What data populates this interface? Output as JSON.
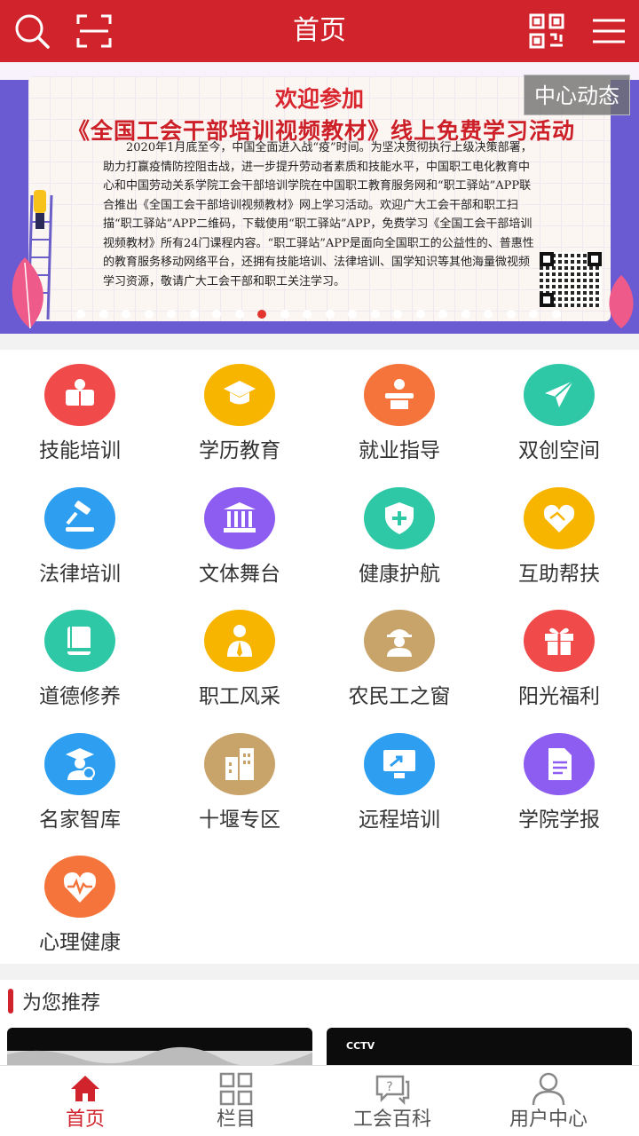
{
  "header": {
    "title": "首页",
    "left_icons": [
      "search-icon",
      "scan-icon"
    ],
    "right_icons": [
      "qrcode-icon",
      "menu-icon"
    ],
    "bg_color": "#d0232c"
  },
  "banner": {
    "headline": "欢迎参加",
    "title": "《全国工会干部培训视频教材》线上免费学习活动",
    "body": "2020年1月底至今，中国全面进入战“疫”时间。为坚决贯彻执行上级决策部署，助力打赢疫情防控阻击战，进一步提升劳动者素质和技能水平，中国职工电化教育中心和中国劳动关系学院工会干部培训学院在中国职工教育服务网和“职工驿站”APP联合推出《全国工会干部培训视频教材》网上学习活动。欢迎广大工会干部和职工扫描“职工驿站”APP二维码，下载使用“职工驿站”APP，免费学习《全国工会干部培训视频教材》所有24门课程内容。“职工驿站”APP是面向全国职工的公益性的、普惠性的教育服务移动网络平台，还拥有技能培训、法律培训、国学知识等其他海量微视频学习资源，敬请广大工会干部和职工关注学习。",
    "tag": "中心动态",
    "dot_count": 22,
    "active_dot": 8
  },
  "grid": {
    "items": [
      {
        "label": "技能培训",
        "icon": "reading-icon",
        "color": "#f04a4a"
      },
      {
        "label": "学历教育",
        "icon": "graduation-cap-icon",
        "color": "#f7b500"
      },
      {
        "label": "就业指导",
        "icon": "speaker-podium-icon",
        "color": "#f5743b"
      },
      {
        "label": "双创空间",
        "icon": "paper-plane-icon",
        "color": "#2ec8a6"
      },
      {
        "label": "法律培训",
        "icon": "gavel-icon",
        "color": "#2e9ff0"
      },
      {
        "label": "文体舞台",
        "icon": "building-columns-icon",
        "color": "#8c5df0"
      },
      {
        "label": "健康护航",
        "icon": "shield-plus-icon",
        "color": "#2ec8a6"
      },
      {
        "label": "互助帮扶",
        "icon": "heart-handshake-icon",
        "color": "#f7b500"
      },
      {
        "label": "道德修养",
        "icon": "book-icon",
        "color": "#2ec8a6"
      },
      {
        "label": "职工风采",
        "icon": "worker-icon",
        "color": "#f7b500"
      },
      {
        "label": "农民工之窗",
        "icon": "helmet-worker-icon",
        "color": "#c9a46a"
      },
      {
        "label": "阳光福利",
        "icon": "gift-icon",
        "color": "#f04a4a"
      },
      {
        "label": "名家智库",
        "icon": "scholar-icon",
        "color": "#2e9ff0"
      },
      {
        "label": "十堰专区",
        "icon": "buildings-icon",
        "color": "#c9a46a"
      },
      {
        "label": "远程培训",
        "icon": "monitor-arrow-icon",
        "color": "#2e9ff0"
      },
      {
        "label": "学院学报",
        "icon": "document-icon",
        "color": "#8c5df0"
      },
      {
        "label": "心理健康",
        "icon": "heart-pulse-icon",
        "color": "#f5743b"
      }
    ]
  },
  "recommend": {
    "title": "为您推荐",
    "card2_logo": "CCTV"
  },
  "tabbar": {
    "items": [
      {
        "label": "首页",
        "icon": "home-icon",
        "active": true
      },
      {
        "label": "栏目",
        "icon": "grid-icon",
        "active": false
      },
      {
        "label": "工会百科",
        "icon": "question-chat-icon",
        "active": false
      },
      {
        "label": "用户中心",
        "icon": "user-icon",
        "active": false
      }
    ],
    "active_color": "#d0232c"
  }
}
